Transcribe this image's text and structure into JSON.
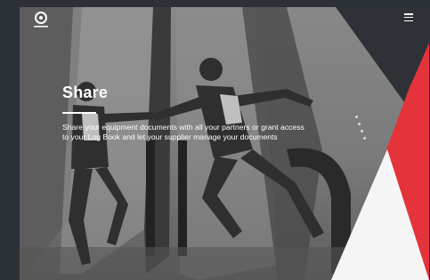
{
  "hero": {
    "headline": "Share",
    "description": "Share your equipment documents with all your partners or grant access to your Log Book and let your supplier manage your documents"
  },
  "header": {
    "logo_icon": "brand-logo-icon",
    "menu_icon": "hamburger-menu-icon"
  },
  "carousel": {
    "slide_count": 4,
    "dots": [
      "slide-1",
      "slide-2",
      "slide-3",
      "slide-4"
    ]
  },
  "colors": {
    "accent_red": "#e4333b",
    "dark_panel": "#2e3236",
    "text": "#ffffff"
  }
}
